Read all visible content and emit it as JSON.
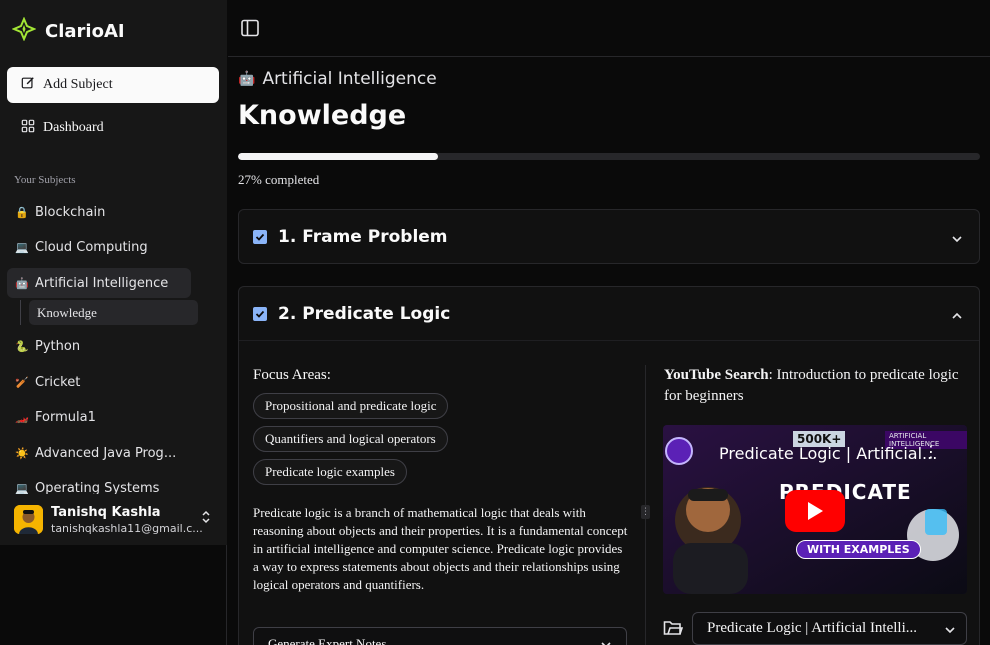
{
  "app": {
    "name": "ClarioAI"
  },
  "sidebar": {
    "add_subject_label": "Add Subject",
    "dashboard_label": "Dashboard",
    "group_label": "Your Subjects",
    "subjects": [
      {
        "emoji": "🔒",
        "label": "Blockchain"
      },
      {
        "emoji": "💻",
        "label": "Cloud Computing"
      },
      {
        "emoji": "🤖",
        "label": "Artificial Intelligence"
      },
      {
        "emoji": "🐍",
        "label": "Python"
      },
      {
        "emoji": "🏏",
        "label": "Cricket"
      },
      {
        "emoji": "🏎️",
        "label": "Formula1"
      },
      {
        "emoji": "☀️",
        "label": "Advanced Java Prog..."
      },
      {
        "emoji": "💻",
        "label": "Operating Systems"
      }
    ],
    "active_sub_item": "Knowledge",
    "user": {
      "name": "Tanishq Kashla",
      "email": "tanishqkashla11@gmail.c..."
    }
  },
  "main": {
    "breadcrumb_emoji": "🤖",
    "breadcrumb": "Artificial Intelligence",
    "title": "Knowledge",
    "progress_value": 0.27,
    "progress_text": "27% completed",
    "sections": [
      {
        "title": "1. Frame Problem",
        "checked": true,
        "expanded": false
      },
      {
        "title": "2. Predicate Logic",
        "checked": true,
        "expanded": true
      }
    ],
    "focus": {
      "label": "Focus Areas",
      "label_suffix": ":",
      "areas": [
        "Propositional and predicate logic",
        "Quantifiers and logical operators",
        "Predicate logic examples"
      ]
    },
    "description": "Predicate logic is a branch of mathematical logic that deals with reasoning about objects and their properties. It is a fundamental concept in artificial intelligence and computer science. Predicate logic provides a way to express statements about objects and their relationships using logical operators and quantifiers.",
    "generate_notes_label": "Generate Expert Notes",
    "youtube": {
      "label": "YouTube Search",
      "query": ": Introduction to predicate logic for beginners",
      "video_title": "Predicate Logic | Artificial...",
      "thumb_big_text": "PREDICATE",
      "thumb_badge": "WITH EXAMPLES",
      "thumb_views": "500K+",
      "thumb_tag": "ARTIFICIAL INTELLIGENCE",
      "selected_video": "Predicate Logic | Artificial Intelli..."
    }
  },
  "colors": {
    "accent_check": "#8ab4f8",
    "progress": "#f4f4f5",
    "youtube_red": "#ff0000"
  }
}
